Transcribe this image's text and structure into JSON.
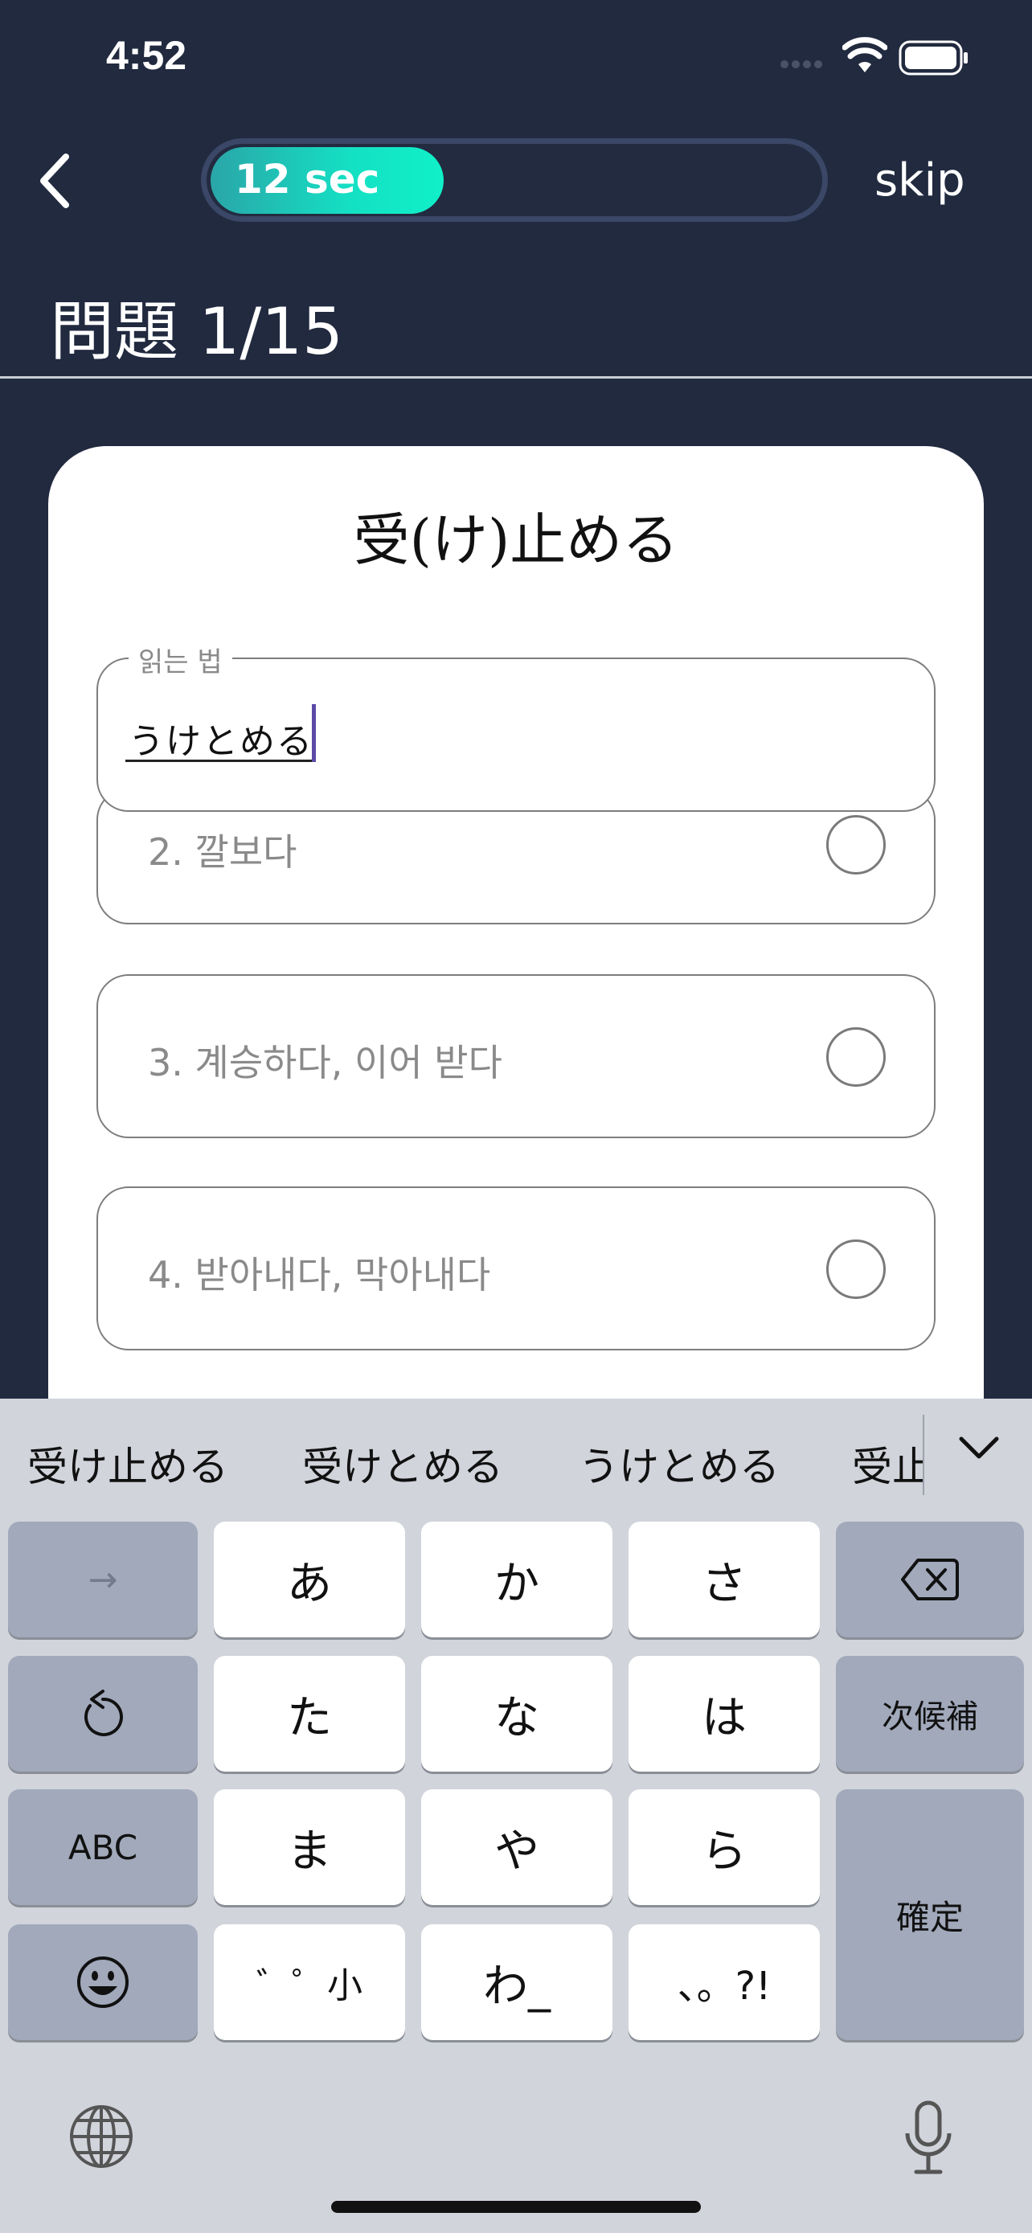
{
  "status_bar": {
    "time": "4:52"
  },
  "header": {
    "timer_label": "12 sec",
    "timer_progress": 0.35,
    "skip_label": "skip"
  },
  "question": {
    "counter": "問題 1/15",
    "word": "受(け)止める"
  },
  "reading_input": {
    "legend": "읽는 법",
    "value": "うけとめる"
  },
  "options": [
    {
      "label": "2. 깔보다"
    },
    {
      "label": "3. 계승하다, 이어 받다"
    },
    {
      "label": "4. 받아내다, 막아내다"
    }
  ],
  "keyboard": {
    "suggestions": [
      "受け止める",
      "受けとめる",
      "うけとめる",
      "受止"
    ],
    "keys": {
      "arrow": "→",
      "a": "あ",
      "ka": "か",
      "sa": "さ",
      "ta": "た",
      "na": "な",
      "ha": "は",
      "next_candidate": "次候補",
      "abc": "ABC",
      "ma": "ま",
      "ya": "や",
      "ra": "ら",
      "confirm": "確定",
      "dakuten": "゛゜小",
      "wa": "わ_",
      "punct": "、。?!"
    }
  },
  "colors": {
    "background": "#212a3f",
    "timer_accent": "#14e0c4",
    "caret": "#5b4aa6"
  },
  "icons": [
    "back-chevron-icon",
    "signal-icon",
    "wifi-icon",
    "battery-icon",
    "radio-icon",
    "chevron-down-icon",
    "delete-icon",
    "undo-icon",
    "emoji-icon",
    "globe-icon",
    "mic-icon"
  ]
}
